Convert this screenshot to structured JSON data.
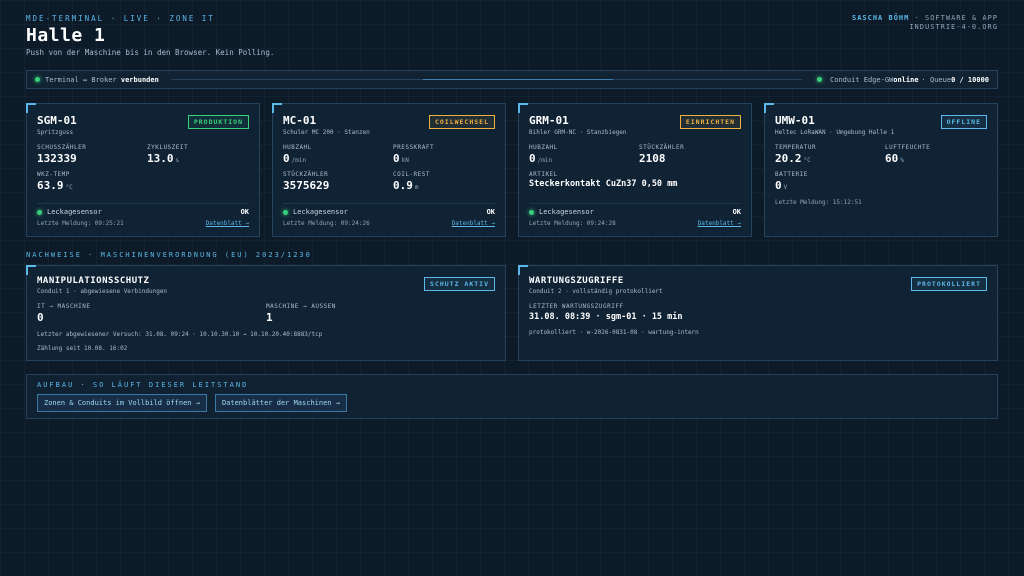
{
  "header": {
    "kicker": "MDE-TERMINAL · LIVE · ZONE IT",
    "title": "Halle 1",
    "subtitle": "Push von der Maschine bis in den Browser. Kein Polling.",
    "author_name": "SASCHA BÖHM",
    "author_role": "· SOFTWARE & APP",
    "author_site": "INDUSTRIE-4-0.ORG"
  },
  "statusbar": {
    "left_label": "Terminal ↔ Broker",
    "left_state": "verbunden",
    "right_label": "Conduit Edge-GW",
    "right_state": "online",
    "queue_label": "· Queue",
    "queue_value": "0 / 10000"
  },
  "machines": [
    {
      "id": "SGM-01",
      "type": "Spritzguss",
      "badge": "PRODUKTION",
      "m1_label": "SCHUSSZÄHLER",
      "m1_value": "132339",
      "m2_label": "ZYKLUSZEIT",
      "m2_value": "13.0",
      "m2_unit": "s",
      "m3_label": "WKZ-TEMP",
      "m3_value": "63.9",
      "m3_unit": "°C",
      "sensor": "Leckagesensor",
      "sensor_state": "OK",
      "last": "Letzte Meldung: 09:25:21",
      "link": "Datenblatt →"
    },
    {
      "id": "MC-01",
      "type": "Schuler MC 200 · Stanzen",
      "badge": "COILWECHSEL",
      "m1_label": "HUBZAHL",
      "m1_value": "0",
      "m1_unit": "/min",
      "m2_label": "PRESSKRAFT",
      "m2_value": "0",
      "m2_unit": "kN",
      "m3_label": "STÜCKZÄHLER",
      "m3_value": "3575629",
      "m4_label": "COIL-REST",
      "m4_value": "0.9",
      "m4_unit": "m",
      "sensor": "Leckagesensor",
      "sensor_state": "OK",
      "last": "Letzte Meldung: 09:24:26",
      "link": "Datenblatt →"
    },
    {
      "id": "GRM-01",
      "type": "Bihler GRM-NC · Stanzbiegen",
      "badge": "EINRICHTEN",
      "m1_label": "HUBZAHL",
      "m1_value": "0",
      "m1_unit": "/min",
      "m2_label": "STÜCKZÄHLER",
      "m2_value": "2108",
      "m3_label": "ARTIKEL",
      "m3_value": "Steckerkontakt CuZn37 0,50 mm",
      "sensor": "Leckagesensor",
      "sensor_state": "OK",
      "last": "Letzte Meldung: 09:24:28",
      "link": "Datenblatt →"
    },
    {
      "id": "UMW-01",
      "type": "Heltec LoRaWAN · Umgebung Halle 1",
      "badge": "OFFLINE",
      "m1_label": "TEMPERATUR",
      "m1_value": "20.2",
      "m1_unit": "°C",
      "m2_label": "LUFTFEUCHTE",
      "m2_value": "60",
      "m2_unit": "%",
      "m3_label": "BATTERIE",
      "m3_value": "0",
      "m3_unit": "V",
      "last": "Letzte Meldung: 15:12:51"
    }
  ],
  "section_label": "NACHWEISE · MASCHINENVERORDNUNG (EU) 2023/1230",
  "manipulation": {
    "title": "MANIPULATIONSSCHUTZ",
    "sub": "Conduit 1 · abgewiesene Verbindungen",
    "badge": "SCHUTZ AKTIV",
    "c1_label": "IT → MASCHINE",
    "c1_value": "0",
    "c2_label": "MASCHINE → AUSSEN",
    "c2_value": "1",
    "note1": "Letzter abgewiesener Versuch: 31.08. 09:24 · 10.10.30.10 → 10.10.20.40:8883/tcp",
    "note2": "Zählung seit 10.08. 16:02"
  },
  "wartung": {
    "title": "WARTUNGSZUGRIFFE",
    "sub": "Conduit 2 · vollständig protokolliert",
    "badge": "PROTOKOLLIERT",
    "c1_label": "LETZTER WARTUNGSZUGRIFF",
    "c1_value": "31.08. 08:39 · sgm-01 · 15 min",
    "note1": "protokolliert · w-2026-0831-08 · wartung-intern"
  },
  "aufbau": {
    "label": "AUFBAU · SO LÄUFT DIESER LEITSTAND",
    "btn1": "Zonen & Conduits im Vollbild öffnen →",
    "btn2": "Datenblätter der Maschinen →"
  },
  "colors": {
    "background": "#0d1b29",
    "accent": "#5bb8e8",
    "ok": "#38d07a",
    "warning": "#f0b040"
  }
}
